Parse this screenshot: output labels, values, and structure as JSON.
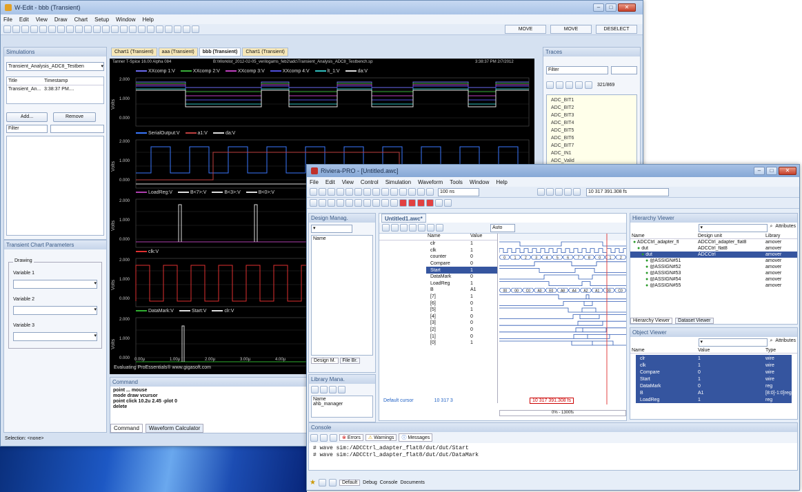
{
  "wedit": {
    "title": "W-Edit - bbb (Transient)",
    "menu": [
      "File",
      "Edit",
      "View",
      "Draw",
      "Chart",
      "Setup",
      "Window",
      "Help"
    ],
    "move1": "MOVE",
    "move2": "MOVE",
    "deselect": "DESELECT",
    "tabs": [
      "Chart1 (Transient)",
      "aaa (Transient)",
      "bbb (Transient)",
      "Chart1 (Transient)"
    ],
    "sim_header": "Simulations",
    "sim_select": "Transient_Analysis_ADC8_Testben",
    "sim_table": {
      "headers": [
        "Title",
        "Timestamp"
      ],
      "rows": [
        [
          "Transient_An...",
          "3:38:37 PM...."
        ]
      ]
    },
    "add": "Add...",
    "remove": "Remove",
    "filter": "Filter",
    "params_header": "Transient Chart Parameters",
    "drawing": "Drawing",
    "var1": "Variable 1",
    "var2": "Variable 2",
    "var3": "Variable 3",
    "traces_header": "Traces",
    "traces_filter": "Filter",
    "traces_count": "321/869",
    "traces": [
      "ADC_BIT1",
      "ADC_BIT2",
      "ADC_BIT3",
      "ADC_BIT4",
      "ADC_BIT5",
      "ADC_BIT6",
      "ADC_BIT7",
      "ADC_IN1",
      "ADC_Valid"
    ],
    "plot_title": "Tanner T-Spice 16.00 Alpha 084",
    "plot_path": "B:\\Worklist_2012-02-05_verilogams_feb2\\adc\\Transient_Analysis_ADC8_Testbench.sp",
    "plot_time": "3:38:37 PM 2/7/2012",
    "lanes": [
      {
        "legend": [
          "XXcomp 1:V",
          "XXcomp 2:V",
          "XXcomp 3:V",
          "XXcomp 4:V",
          "lt_1:V",
          "da:V"
        ],
        "colors": [
          "#6a6af0",
          "#3ab03a",
          "#c040c0",
          "#5050e0",
          "#30c0c0",
          "#e0e0e0"
        ],
        "ticks": [
          "2.000",
          "1.000",
          "0.000"
        ]
      },
      {
        "legend": [
          "SerialOutput:V",
          "a1:V",
          "da:V"
        ],
        "colors": [
          "#3a78ff",
          "#c04040",
          "#e0e0e0"
        ],
        "ticks": [
          "2.000",
          "1.000",
          "0.000"
        ]
      },
      {
        "legend": [
          "LoadReg:V",
          "B<7>:V",
          "B<3>:V",
          "B<0>:V"
        ],
        "colors": [
          "#b040b0",
          "#e0e0e0",
          "#e0e0e0",
          "#e0e0e0"
        ],
        "ticks": [
          "2.000",
          "1.000",
          "0.000"
        ]
      },
      {
        "legend": [
          "clk:V"
        ],
        "colors": [
          "#e03030"
        ],
        "ticks": [
          "2.000",
          "1.000",
          "0.000"
        ]
      },
      {
        "legend": [
          "DataMark:V",
          "Start:V",
          "clr:V"
        ],
        "colors": [
          "#30b030",
          "#e0e0e0",
          "#e0e0e0"
        ],
        "ticks": [
          "2.000",
          "1.000",
          "0.000"
        ]
      }
    ],
    "ylabel": "Volts",
    "xticks": [
      "0.00µ",
      "1.00µ",
      "2.00µ",
      "3.00µ",
      "4.00µ",
      "5.00µ"
    ],
    "eval_text": "Evaluating ProEssentials® www.gigasoft.com",
    "command_header": "Command",
    "command_lines": [
      "point ... mouse",
      "mode draw vcursor",
      "point click 10.2u 2.45 -plot 0",
      "delete"
    ],
    "cmd_tabs": [
      "Command",
      "Waveform Calculator"
    ],
    "status": "Selection: <none>"
  },
  "riviera": {
    "title": "Riviera-PRO - [Untitled.awc]",
    "menu": [
      "File",
      "Edit",
      "View",
      "Control",
      "Simulation",
      "Waveform",
      "Tools",
      "Window",
      "Help"
    ],
    "time_field": "100 ns",
    "cursor_field": "10 317 391.308 fs",
    "design_header": "Design Manag.",
    "design_name_col": "Name",
    "design_tabs": [
      "Design M.",
      "File Br."
    ],
    "library_header": "Library Mana.",
    "lib_name_col": "Name",
    "lib_item": "ahb_manager",
    "wave_tab": "Untitled1.awc*",
    "sig_headers": [
      "Name",
      "Value"
    ],
    "signals": [
      [
        "clr",
        "1"
      ],
      [
        "clk",
        "1"
      ],
      [
        "counter",
        "0"
      ],
      [
        "Compare",
        "0"
      ],
      [
        "Start",
        "1"
      ],
      [
        "DataMark",
        "0"
      ],
      [
        "LoadReg",
        "1"
      ],
      [
        "B",
        "A1"
      ],
      [
        "[7]",
        "1"
      ],
      [
        "[6]",
        "0"
      ],
      [
        "[5]",
        "1"
      ],
      [
        "[4]",
        "0"
      ],
      [
        "[3]",
        "0"
      ],
      [
        "[2]",
        "0"
      ],
      [
        "[1]",
        "0"
      ],
      [
        "[0]",
        "1"
      ]
    ],
    "default_cursor": "Default cursor",
    "cursor_value": "10 317 3",
    "cursor_box": "10 317 391.308 fs",
    "auto_label": "Auto",
    "time_ruler": "0% - 1300fs",
    "counter_vals": [
      "0",
      "1",
      "2",
      "3",
      "4",
      "5",
      "6",
      "7",
      "8",
      "0",
      "1",
      "2"
    ],
    "b_vals": [
      "00",
      "00",
      "C0",
      "A0",
      "E0",
      "A8",
      "A4",
      "A2",
      "A1",
      "00",
      "C0"
    ],
    "hier_header": "Hierarchy Viewer",
    "hier_cols": [
      "Name",
      "Design unit",
      "Library"
    ],
    "hier_rows": [
      [
        "ADCCtrl_adapter_fl",
        "ADCCtrl_adapter_flat8",
        "amover"
      ],
      [
        "dut",
        "ADCCtrl_flat8",
        "amover"
      ],
      [
        "dut",
        "ADCCtrl",
        "amover"
      ],
      [
        "@ASSIGN#51",
        "",
        "amover"
      ],
      [
        "@ASSIGN#52",
        "",
        "amover"
      ],
      [
        "@ASSIGN#53",
        "",
        "amover"
      ],
      [
        "@ASSIGN#54",
        "",
        "amover"
      ],
      [
        "@ASSIGN#55",
        "",
        "amover"
      ]
    ],
    "hier_tabs": [
      "Hierarchy Viewer",
      "Dataset Viewer"
    ],
    "attributes": "Attributes",
    "obj_header": "Object Viewer",
    "obj_cols": [
      "Name",
      "Value",
      "Type"
    ],
    "obj_rows": [
      [
        "clr",
        "1",
        "wire"
      ],
      [
        "clk",
        "1",
        "wire"
      ],
      [
        "Compare",
        "0",
        "wire"
      ],
      [
        "Start",
        "1",
        "wire"
      ],
      [
        "DataMark",
        "0",
        "reg"
      ],
      [
        "B",
        "A1",
        "[8:0]-1:0]reg"
      ],
      [
        "LoadReg",
        "1",
        "reg"
      ]
    ],
    "console_header": "Console",
    "console_tabs": [
      "Errors",
      "Warnings",
      "Messages"
    ],
    "console_lines": [
      "# wave sim:/ADCCtrl_adapter_flat8/dut/dut/Start",
      "# wave sim:/ADCCtrl_adapter_flat8/dut/dut/DataMark"
    ],
    "bottom_tabs": [
      "Default",
      "Debug",
      "Console",
      "Documents"
    ]
  }
}
